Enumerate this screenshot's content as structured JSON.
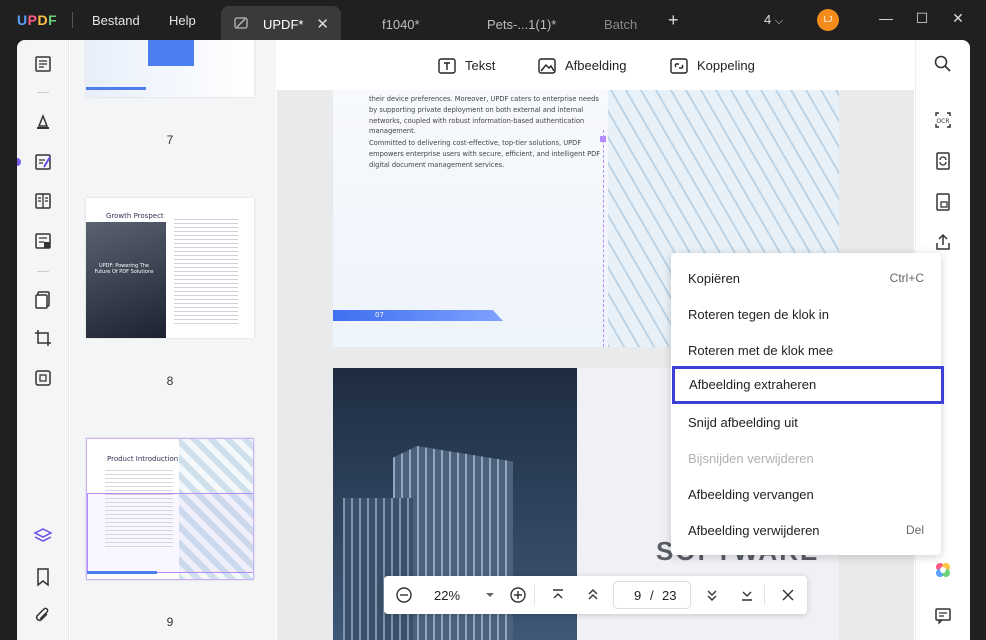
{
  "app": {
    "logo": "UPDF"
  },
  "menu": {
    "file": "Bestand",
    "help": "Help"
  },
  "tabs": [
    {
      "label": "UPDF*",
      "active": true
    },
    {
      "label": "f1040*"
    },
    {
      "label": "Pets-...1(1)*"
    },
    {
      "label": "Batch"
    }
  ],
  "window": {
    "tab_count": "4",
    "avatar": "LJ"
  },
  "toolbar": {
    "text": "Tekst",
    "image": "Afbeelding",
    "link": "Koppeling"
  },
  "thumbnails": [
    {
      "page": "7"
    },
    {
      "page": "8",
      "title": "Growth Prospect",
      "subtitle": "UPDF: Powering The Future Of PDF Solutions"
    },
    {
      "page": "9",
      "title": "Product Introduction"
    }
  ],
  "page7": {
    "paragraph1": "their device preferences. Moreover, UPDF caters to enterprise needs by supporting private deployment on both external and internal networks, coupled with robust information-based authentication management.",
    "paragraph2": "Committed to delivering cost-effective, top-tier solutions, UPDF empowers enterprise users with secure, efficient, and intelligent PDF digital document management services.",
    "page_label": "07"
  },
  "page9": {
    "big_text": "SOFTWARE"
  },
  "context_menu": {
    "items": [
      {
        "label": "Kopiëren",
        "shortcut": "Ctrl+C"
      },
      {
        "label": "Roteren tegen de klok in"
      },
      {
        "label": "Roteren met de klok mee"
      },
      {
        "label": "Afbeelding extraheren",
        "highlighted": true
      },
      {
        "label": "Snijd afbeelding uit"
      },
      {
        "label": "Bijsnijden verwijderen",
        "disabled": true
      },
      {
        "label": "Afbeelding vervangen"
      },
      {
        "label": "Afbeelding verwijderen",
        "shortcut": "Del"
      }
    ]
  },
  "zoom": {
    "value": "22%",
    "current_page": "9",
    "separator": "/",
    "total_pages": "23"
  },
  "colors": {
    "accent": "#3b3fd4",
    "selection": "#b58cff",
    "avatar": "#f28c1c"
  }
}
